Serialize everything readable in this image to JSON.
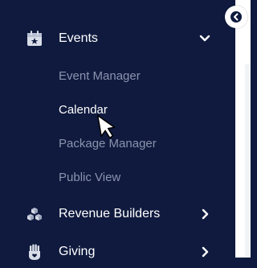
{
  "nav": {
    "events": {
      "label": "Events",
      "icon": "calendar-star-icon",
      "expanded": true
    },
    "sub_items": [
      {
        "label": "Event Manager",
        "active": false
      },
      {
        "label": "Calendar",
        "active": true
      },
      {
        "label": "Package Manager",
        "active": false
      },
      {
        "label": "Public View",
        "active": false
      }
    ],
    "revenue_builders": {
      "label": "Revenue Builders",
      "icon": "boxes-icon"
    },
    "giving": {
      "label": "Giving",
      "icon": "hand-heart-icon"
    }
  },
  "colors": {
    "sidebar_bg": "#0f1a3e",
    "text_active": "#ffffff",
    "text_muted": "#8a93ad"
  }
}
